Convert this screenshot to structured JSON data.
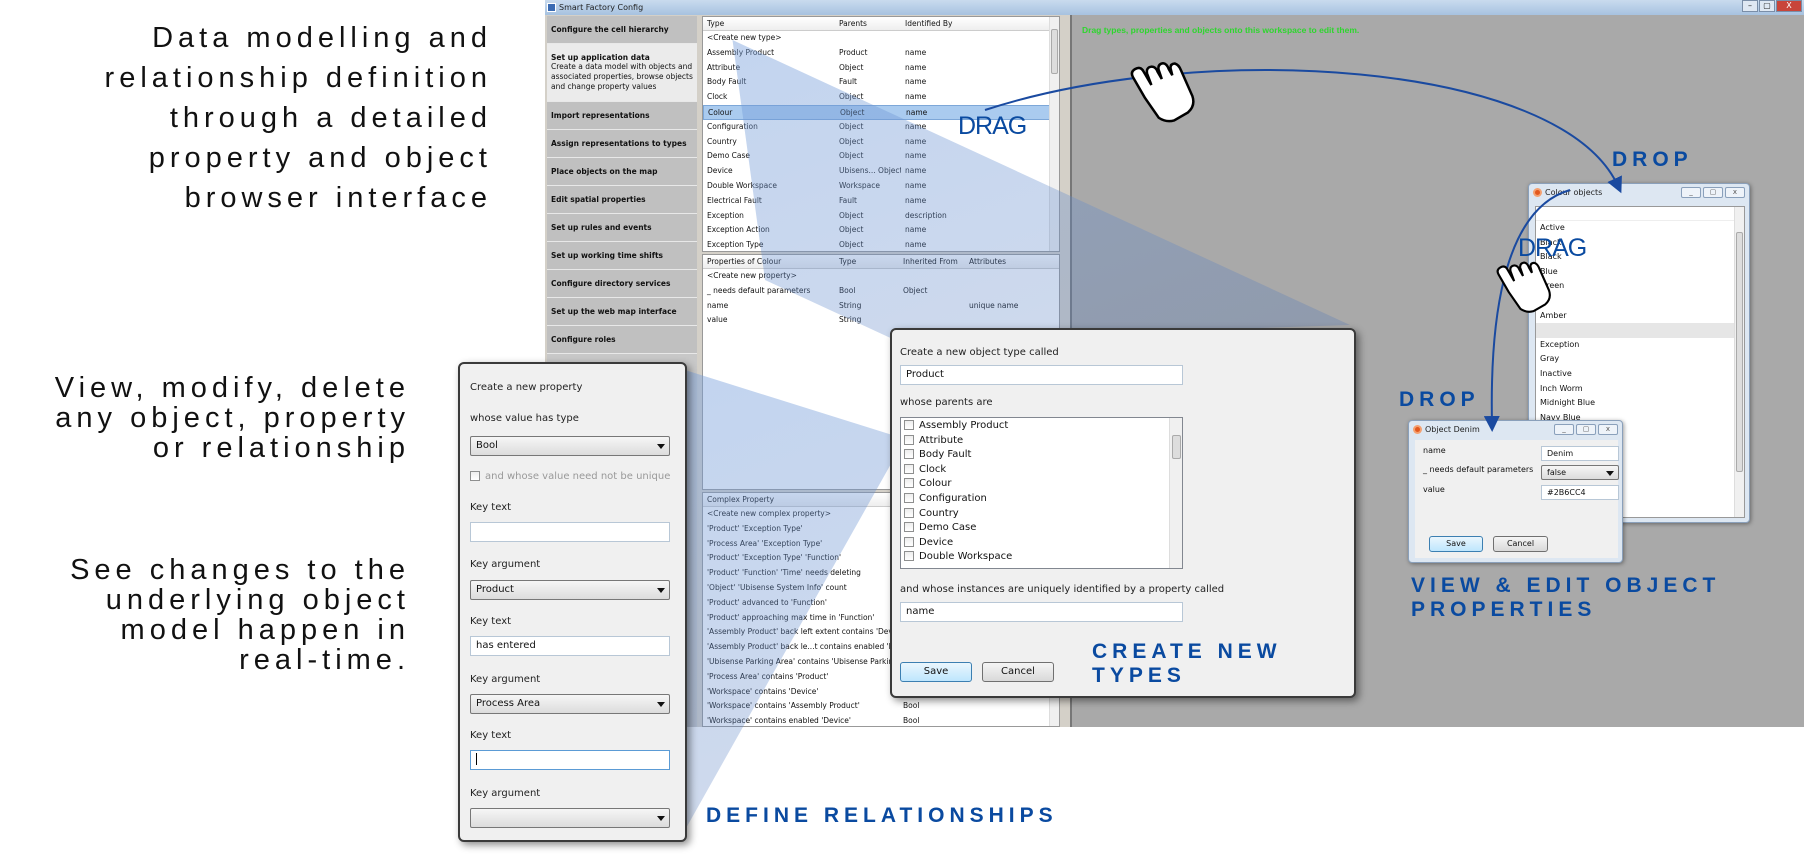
{
  "captions": {
    "main": [
      "Data modelling and",
      "relationship definition",
      "through a detailed",
      "property and object",
      "browser interface"
    ],
    "view_modify": [
      "View, modify, delete",
      "any object, property",
      "or relationship"
    ],
    "realtime": [
      "See changes to the",
      "underlying object",
      "model happen in",
      "real-time."
    ]
  },
  "labels": {
    "drag_1": "DRAG",
    "drop_1": "DROP",
    "drag_2": "DRAG",
    "drop_2": "DROP",
    "create_new_types": [
      "CREATE NEW",
      "TYPES"
    ],
    "view_edit": [
      "VIEW & EDIT OBJECT",
      "PROPERTIES"
    ],
    "define_relationships": "DEFINE RELATIONSHIPS"
  },
  "window": {
    "title": "Smart Factory Config",
    "buttons": {
      "minimize": "–",
      "maximize": "▢",
      "close": "X"
    }
  },
  "sidebar": {
    "items": [
      {
        "label": "Configure the cell hierarchy"
      },
      {
        "label": "Set up application data",
        "desc": "Create a data model with objects and associated properties, browse objects and change property values",
        "active": true
      },
      {
        "label": "Import representations"
      },
      {
        "label": "Assign representations to types"
      },
      {
        "label": "Place objects on the map"
      },
      {
        "label": "Edit spatial properties"
      },
      {
        "label": "Set up rules and events"
      },
      {
        "label": "Set up working time shifts"
      },
      {
        "label": "Configure directory services"
      },
      {
        "label": "Set up the web map interface"
      },
      {
        "label": "Configure roles"
      }
    ]
  },
  "types_table": {
    "headers": [
      "Type",
      "Parents",
      "Identified By"
    ],
    "rows": [
      [
        "<Create new type>",
        "",
        ""
      ],
      [
        "Assembly Product",
        "Product",
        "name"
      ],
      [
        "Attribute",
        "Object",
        "name"
      ],
      [
        "Body Fault",
        "Fault",
        "name"
      ],
      [
        "Clock",
        "Object",
        "name"
      ],
      [
        "Colour",
        "Object",
        "name"
      ],
      [
        "Configuration",
        "Object",
        "name"
      ],
      [
        "Country",
        "Object",
        "name"
      ],
      [
        "Demo Case",
        "Object",
        "name"
      ],
      [
        "Device",
        "Ubisens... Object",
        "name"
      ],
      [
        "Double Workspace",
        "Workspace",
        "name"
      ],
      [
        "Electrical Fault",
        "Fault",
        "name"
      ],
      [
        "Exception",
        "Object",
        "description"
      ],
      [
        "Exception Action",
        "Object",
        "name"
      ],
      [
        "Exception Type",
        "Object",
        "name"
      ]
    ],
    "selected_index": 5
  },
  "properties_table": {
    "headers": [
      "Properties of Colour",
      "Type",
      "Inherited From",
      "Attributes"
    ],
    "rows": [
      [
        "<Create new property>",
        "",
        "",
        ""
      ],
      [
        "_ needs default parameters",
        "Bool",
        "Object",
        ""
      ],
      [
        "name",
        "String",
        "",
        "unique name"
      ],
      [
        "value",
        "String",
        "",
        ""
      ]
    ]
  },
  "complex_table": {
    "headers": [
      "Complex Property",
      ""
    ],
    "rows": [
      [
        "<Create new complex property>",
        ""
      ],
      [
        "'Product' 'Exception Type'",
        ""
      ],
      [
        "'Process Area' 'Exception Type'",
        ""
      ],
      [
        "'Product' 'Exception Type' 'Function'",
        ""
      ],
      [
        "'Product' 'Function' 'Time' needs deleting",
        ""
      ],
      [
        "'Object' 'Ubisense System Info' count",
        ""
      ],
      [
        "'Product' advanced to 'Function'",
        ""
      ],
      [
        "'Product' approaching max time in 'Function'",
        ""
      ],
      [
        "'Assembly Product' back left extent contains 'Device'",
        ""
      ],
      [
        "'Assembly Product' back le...t contains enabled 'Device'",
        ""
      ],
      [
        "'Ubisense Parking Area' contains 'Ubisense Parking Bay'",
        ""
      ],
      [
        "'Process Area' contains 'Product'",
        ""
      ],
      [
        "'Workspace' contains 'Device'",
        ""
      ],
      [
        "'Workspace' contains 'Assembly Product'",
        "Bool"
      ],
      [
        "'Workspace' contains enabled 'Device'",
        "Bool"
      ]
    ]
  },
  "workspace": {
    "hint": "Drag types, properties and objects onto this workspace to edit them."
  },
  "new_property_dialog": {
    "title": "Create a new property",
    "value_type_label": "whose value has type",
    "value_type": "Bool",
    "unique_checkbox_label": "and whose value need not be unique",
    "unique_checked": false,
    "fields": [
      {
        "label": "Key text",
        "value": ""
      },
      {
        "label": "Key argument",
        "value": "Product"
      },
      {
        "label": "Key text",
        "value": "has entered"
      },
      {
        "label": "Key argument",
        "value": "Process Area"
      },
      {
        "label": "Key text",
        "value": ""
      },
      {
        "label": "Key argument",
        "value": ""
      }
    ]
  },
  "new_type_dialog": {
    "name_label": "Create a new object type called",
    "name_value": "Product",
    "parents_label": "whose parents are",
    "parents": [
      {
        "label": "Assembly Product",
        "checked": false
      },
      {
        "label": "Attribute",
        "checked": false
      },
      {
        "label": "Body Fault",
        "checked": false
      },
      {
        "label": "Clock",
        "checked": false
      },
      {
        "label": "Colour",
        "checked": false
      },
      {
        "label": "Configuration",
        "checked": false
      },
      {
        "label": "Country",
        "checked": false
      },
      {
        "label": "Demo Case",
        "checked": false
      },
      {
        "label": "Device",
        "checked": false
      },
      {
        "label": "Double Workspace",
        "checked": false
      }
    ],
    "id_label": "and whose instances are uniquely identified by a property called",
    "id_value": "name",
    "save_label": "Save",
    "cancel_label": "Cancel"
  },
  "colour_objects_window": {
    "title": "Colour objects",
    "items": [
      "Active",
      "Black",
      "Black",
      "Blue",
      "Green",
      "",
      "Amber",
      "",
      "Exception",
      "Gray",
      "Inactive",
      "Inch Worm",
      "Midnight Blue",
      "Navy Blue"
    ],
    "highlighted_index": 7
  },
  "object_denim_window": {
    "title": "Object Denim",
    "fields": [
      {
        "label": "name",
        "value": "Denim",
        "kind": "text"
      },
      {
        "label": "_ needs default parameters",
        "value": "false",
        "kind": "select"
      },
      {
        "label": "value",
        "value": "#2B6CC4",
        "kind": "text"
      }
    ],
    "save_label": "Save",
    "cancel_label": "Cancel"
  },
  "colors": {
    "accent_blue": "#0a4aa0",
    "hint_green": "#2ed62e",
    "selection": "#aacbef"
  }
}
